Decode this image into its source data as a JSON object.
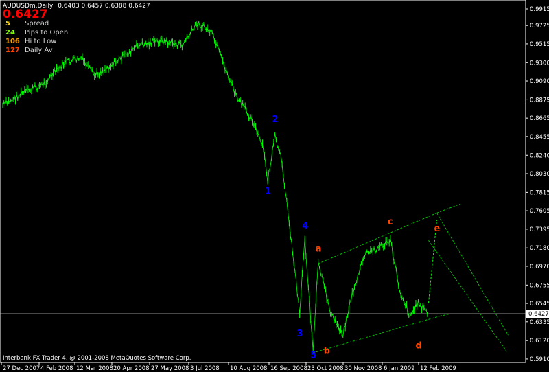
{
  "header": {
    "symbol_line": "AUDUSDm,Daily",
    "ohlc": "0.6403 0.6457 0.6388 0.6427",
    "big_price": "0.6427"
  },
  "info_panel": [
    {
      "value": "5",
      "label": "Spread",
      "color": "#ffd700"
    },
    {
      "value": "24",
      "label": "Pips to Open",
      "color": "#7fff00"
    },
    {
      "value": "106",
      "label": "Hi to Low",
      "color": "#ffa500"
    },
    {
      "value": "127",
      "label": "Daily Av",
      "color": "#ff4500"
    }
  ],
  "footer": "Interbank FX Trader 4, @ 2001-2008 MetaQuotes Software Corp.",
  "colors": {
    "candles": "#00ff00",
    "grid_line": "#c0c0c0",
    "wave_blue": "#0000ff",
    "wave_orange": "#ff4500",
    "channel": "#00c000"
  },
  "chart_data": {
    "type": "line",
    "symbol": "AUDUSDm",
    "timeframe": "Daily",
    "current_price": 0.6427,
    "y_ticks": [
      "0.9915",
      "0.9725",
      "0.9515",
      "0.9300",
      "0.9090",
      "0.8875",
      "0.8665",
      "0.8455",
      "0.8240",
      "0.8030",
      "0.7815",
      "0.7605",
      "0.7395",
      "0.7180",
      "0.6970",
      "0.6755",
      "0.6545",
      "0.6335",
      "0.6120",
      "0.5910"
    ],
    "ylim": [
      0.587,
      0.997
    ],
    "x_ticks": [
      "27 Dec 2007",
      "4 Feb 2008",
      "12 Mar 2008",
      "20 Apr 2008",
      "27 May 2008",
      "3 Jul 2008",
      "10 Aug 2008",
      "16 Sep 2008",
      "23 Oct 2008",
      "30 Nov 2008",
      "6 Jan 2009",
      "12 Feb 2009"
    ],
    "price_path": [
      {
        "date": "27 Dec 2007",
        "price": 0.881
      },
      {
        "date": "15 Jan 2008",
        "price": 0.895
      },
      {
        "date": "4 Feb 2008",
        "price": 0.905
      },
      {
        "date": "25 Feb 2008",
        "price": 0.93
      },
      {
        "date": "12 Mar 2008",
        "price": 0.935
      },
      {
        "date": "25 Mar 2008",
        "price": 0.915
      },
      {
        "date": "20 Apr 2008",
        "price": 0.935
      },
      {
        "date": "7 May 2008",
        "price": 0.95
      },
      {
        "date": "27 May 2008",
        "price": 0.955
      },
      {
        "date": "18 Jun 2008",
        "price": 0.95
      },
      {
        "date": "3 Jul 2008",
        "price": 0.975
      },
      {
        "date": "16 Jul 2008",
        "price": 0.965
      },
      {
        "date": "10 Aug 2008",
        "price": 0.89
      },
      {
        "date": "25 Aug 2008",
        "price": 0.865
      },
      {
        "date": "5 Sep 2008",
        "price": 0.83
      },
      {
        "date": "9 Sep 2008",
        "price": 0.795
      },
      {
        "date": "16 Sep 2008",
        "price": 0.845
      },
      {
        "date": "23 Sep 2008",
        "price": 0.815
      },
      {
        "date": "10 Oct 2008",
        "price": 0.645
      },
      {
        "date": "15 Oct 2008",
        "price": 0.73
      },
      {
        "date": "23 Oct 2008",
        "price": 0.6
      },
      {
        "date": "28 Oct 2008",
        "price": 0.7
      },
      {
        "date": "10 Nov 2008",
        "price": 0.64
      },
      {
        "date": "21 Nov 2008",
        "price": 0.62
      },
      {
        "date": "30 Nov 2008",
        "price": 0.665
      },
      {
        "date": "12 Dec 2008",
        "price": 0.71
      },
      {
        "date": "28 Dec 2008",
        "price": 0.72
      },
      {
        "date": "6 Jan 2009",
        "price": 0.726
      },
      {
        "date": "15 Jan 2009",
        "price": 0.67
      },
      {
        "date": "25 Jan 2009",
        "price": 0.64
      },
      {
        "date": "2 Feb 2009",
        "price": 0.655
      },
      {
        "date": "12 Feb 2009",
        "price": 0.6427
      }
    ],
    "wave_labels": [
      {
        "text": "1",
        "date": "9 Sep 2008",
        "price": 0.78,
        "group": "impulse"
      },
      {
        "text": "2",
        "date": "16 Sep 2008",
        "price": 0.862,
        "group": "impulse"
      },
      {
        "text": "3",
        "date": "10 Oct 2008",
        "price": 0.617,
        "group": "impulse"
      },
      {
        "text": "4",
        "date": "15 Oct 2008",
        "price": 0.74,
        "group": "impulse"
      },
      {
        "text": "5",
        "date": "23 Oct 2008",
        "price": 0.592,
        "group": "impulse"
      },
      {
        "text": "a",
        "date": "28 Oct 2008",
        "price": 0.714,
        "group": "corrective"
      },
      {
        "text": "b",
        "date": "5 Nov 2008",
        "price": 0.597,
        "group": "corrective"
      },
      {
        "text": "c",
        "date": "6 Jan 2009",
        "price": 0.745,
        "group": "corrective"
      },
      {
        "text": "d",
        "date": "2 Feb 2009",
        "price": 0.603,
        "group": "corrective"
      },
      {
        "text": "e",
        "date": "20 Feb 2009",
        "price": 0.737,
        "group": "corrective"
      }
    ],
    "channel_upper": [
      {
        "date": "28 Oct 2008",
        "price": 0.7
      },
      {
        "date": "20 Feb 2009",
        "price": 0.758
      }
    ],
    "channel_lower": [
      {
        "date": "23 Oct 2008",
        "price": 0.598
      },
      {
        "date": "23 Feb 2009",
        "price": 0.64
      }
    ],
    "projection": [
      {
        "date": "12 Feb 2009",
        "price": 0.655
      },
      {
        "date": "20 Feb 2009",
        "price": 0.75
      }
    ],
    "horizontal_line_price": 0.6427,
    "grid": false
  }
}
